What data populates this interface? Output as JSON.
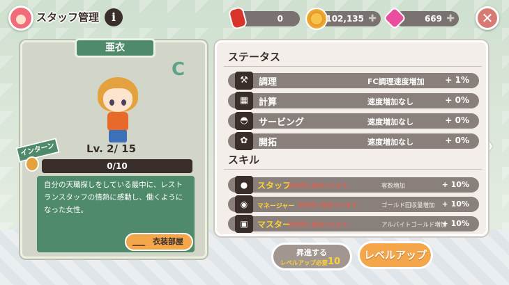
{
  "header": {
    "title": "スタッフ管理",
    "info_label": "i",
    "resources": {
      "cans": "0",
      "coins": "102,135",
      "gems": "669"
    },
    "close_label": "✕"
  },
  "staff": {
    "name": "亜衣",
    "rank": "C",
    "level": "Lv. 2/ 15",
    "badge": "インターン",
    "exp": {
      "text": "0/10",
      "fraction": 0
    },
    "description": "自分の天職探しをしている最中に、レストランスタッフの情熱に感動し、働くようになった女性。",
    "costume_button": "衣装部屋"
  },
  "status": {
    "title": "ステータス",
    "rows": [
      {
        "icon": "spatula-icon",
        "glyph": "⚒",
        "name": "調理",
        "desc": "FC調理速度増加",
        "value": "+ 1%"
      },
      {
        "icon": "calculator-icon",
        "glyph": "▦",
        "name": "計算",
        "desc": "速度増加なし",
        "value": "+ 0%"
      },
      {
        "icon": "cloche-icon",
        "glyph": "◓",
        "name": "サービング",
        "desc": "速度増加なし",
        "value": "+ 0%"
      },
      {
        "icon": "wheat-icon",
        "glyph": "✿",
        "name": "開拓",
        "desc": "速度増加なし",
        "value": "+ 0%"
      }
    ]
  },
  "skills": {
    "title": "スキル",
    "rows": [
      {
        "icon": "bear-icon",
        "glyph": "●",
        "name": "スタッフ",
        "lock": "昇格時に解放されます。",
        "effect": "客数増加",
        "value": "+ 10%"
      },
      {
        "icon": "coin-bag-icon",
        "glyph": "◉",
        "name": "マネージャー",
        "lock": "昇格時に解放されます。",
        "effect": "ゴールド回収量増加",
        "value": "+ 10%"
      },
      {
        "icon": "safe-icon",
        "glyph": "▣",
        "name": "マスター",
        "lock": "昇格時に解放されます。",
        "effect": "アルバイトゴールド増加",
        "value": "+ 10%"
      }
    ]
  },
  "actions": {
    "promote_label": "昇進する",
    "promote_cost_label": "レベルアップ必要",
    "promote_cost": "10",
    "levelup_label": "レベルアップ"
  },
  "nav": {
    "prev": "〈",
    "next": "〉"
  }
}
